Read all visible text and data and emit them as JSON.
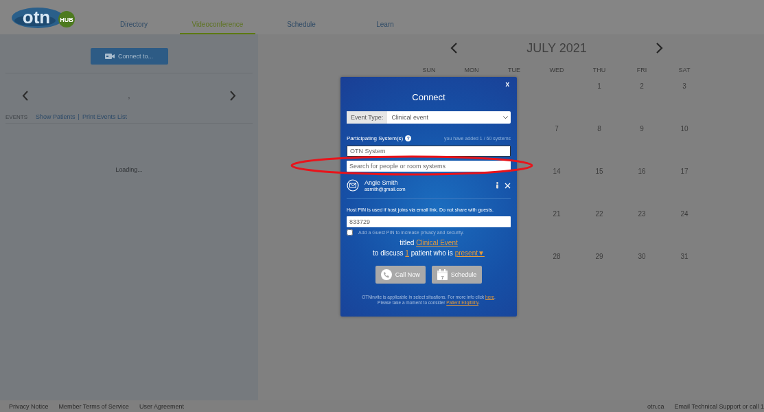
{
  "nav": {
    "logo": {
      "text": "otn",
      "badge": "HUB"
    },
    "tabs": [
      {
        "label": "Directory",
        "selected": false
      },
      {
        "label": "Videoconference",
        "selected": true
      },
      {
        "label": "Schedule",
        "selected": false
      },
      {
        "label": "Learn",
        "selected": false
      }
    ]
  },
  "sidebar": {
    "connect_button": "Connect to...",
    "date_label": ",",
    "events_label": "EVENTS",
    "links": [
      "Show Patients",
      "Print Events List"
    ],
    "separator": "|",
    "status": "Loading..."
  },
  "calendar": {
    "month": "JULY 2021",
    "weekdays": [
      "SUN",
      "MON",
      "TUE",
      "WED",
      "THU",
      "FRI",
      "SAT"
    ],
    "weeks": [
      [
        "1",
        "2",
        "3"
      ],
      [
        "7",
        "8",
        "9",
        "10"
      ],
      [
        "14",
        "15",
        "16",
        "17"
      ],
      [
        "21",
        "22",
        "23",
        "24"
      ],
      [
        "28",
        "29",
        "30",
        "31"
      ]
    ]
  },
  "dialog": {
    "close": "x",
    "title": "Connect",
    "event_type": {
      "label": "Event Type:",
      "value": "Clinical event"
    },
    "participants_label": "Participating System(s)",
    "help": "?",
    "count_note": "you have added 1 / 60 systems",
    "system_field": {
      "placeholder": "OTN System"
    },
    "search_field": {
      "placeholder": "Search for people or room systems"
    },
    "participants": [
      {
        "name": "Angie Smith",
        "email": "asmith@gmail.com"
      }
    ],
    "pin_note": "Host PIN is used if host joins via email link. Do not share with guests.",
    "pin": {
      "value": "833729"
    },
    "guest_pin": {
      "label": "Add a Guest PIN to increase privacy and security.",
      "checked": false
    },
    "titled": {
      "prefix": "titled",
      "link": "Clinical Event"
    },
    "discuss": {
      "prefix": "to discuss",
      "count": "1",
      "middle": "patient who is",
      "status": "present",
      "caret": "▼"
    },
    "buttons": [
      {
        "kind": "call",
        "label": "Call Now"
      },
      {
        "kind": "schedule",
        "label": "Schedule",
        "icon_day": "7"
      }
    ],
    "notes": [
      {
        "text": "OTNinvite is applicable in select situations. For more info click",
        "link": "here",
        "end": "."
      },
      {
        "text": "Please take a moment to consider",
        "link": "Patient Eligibility",
        "end": "."
      }
    ]
  },
  "annotation": {
    "kind": "ellipse"
  },
  "footer": {
    "left": [
      "Privacy Notice",
      "Member Terms of Service",
      "User Agreement"
    ],
    "right": [
      "otn.ca",
      "Email Technical Support or call 1"
    ]
  }
}
